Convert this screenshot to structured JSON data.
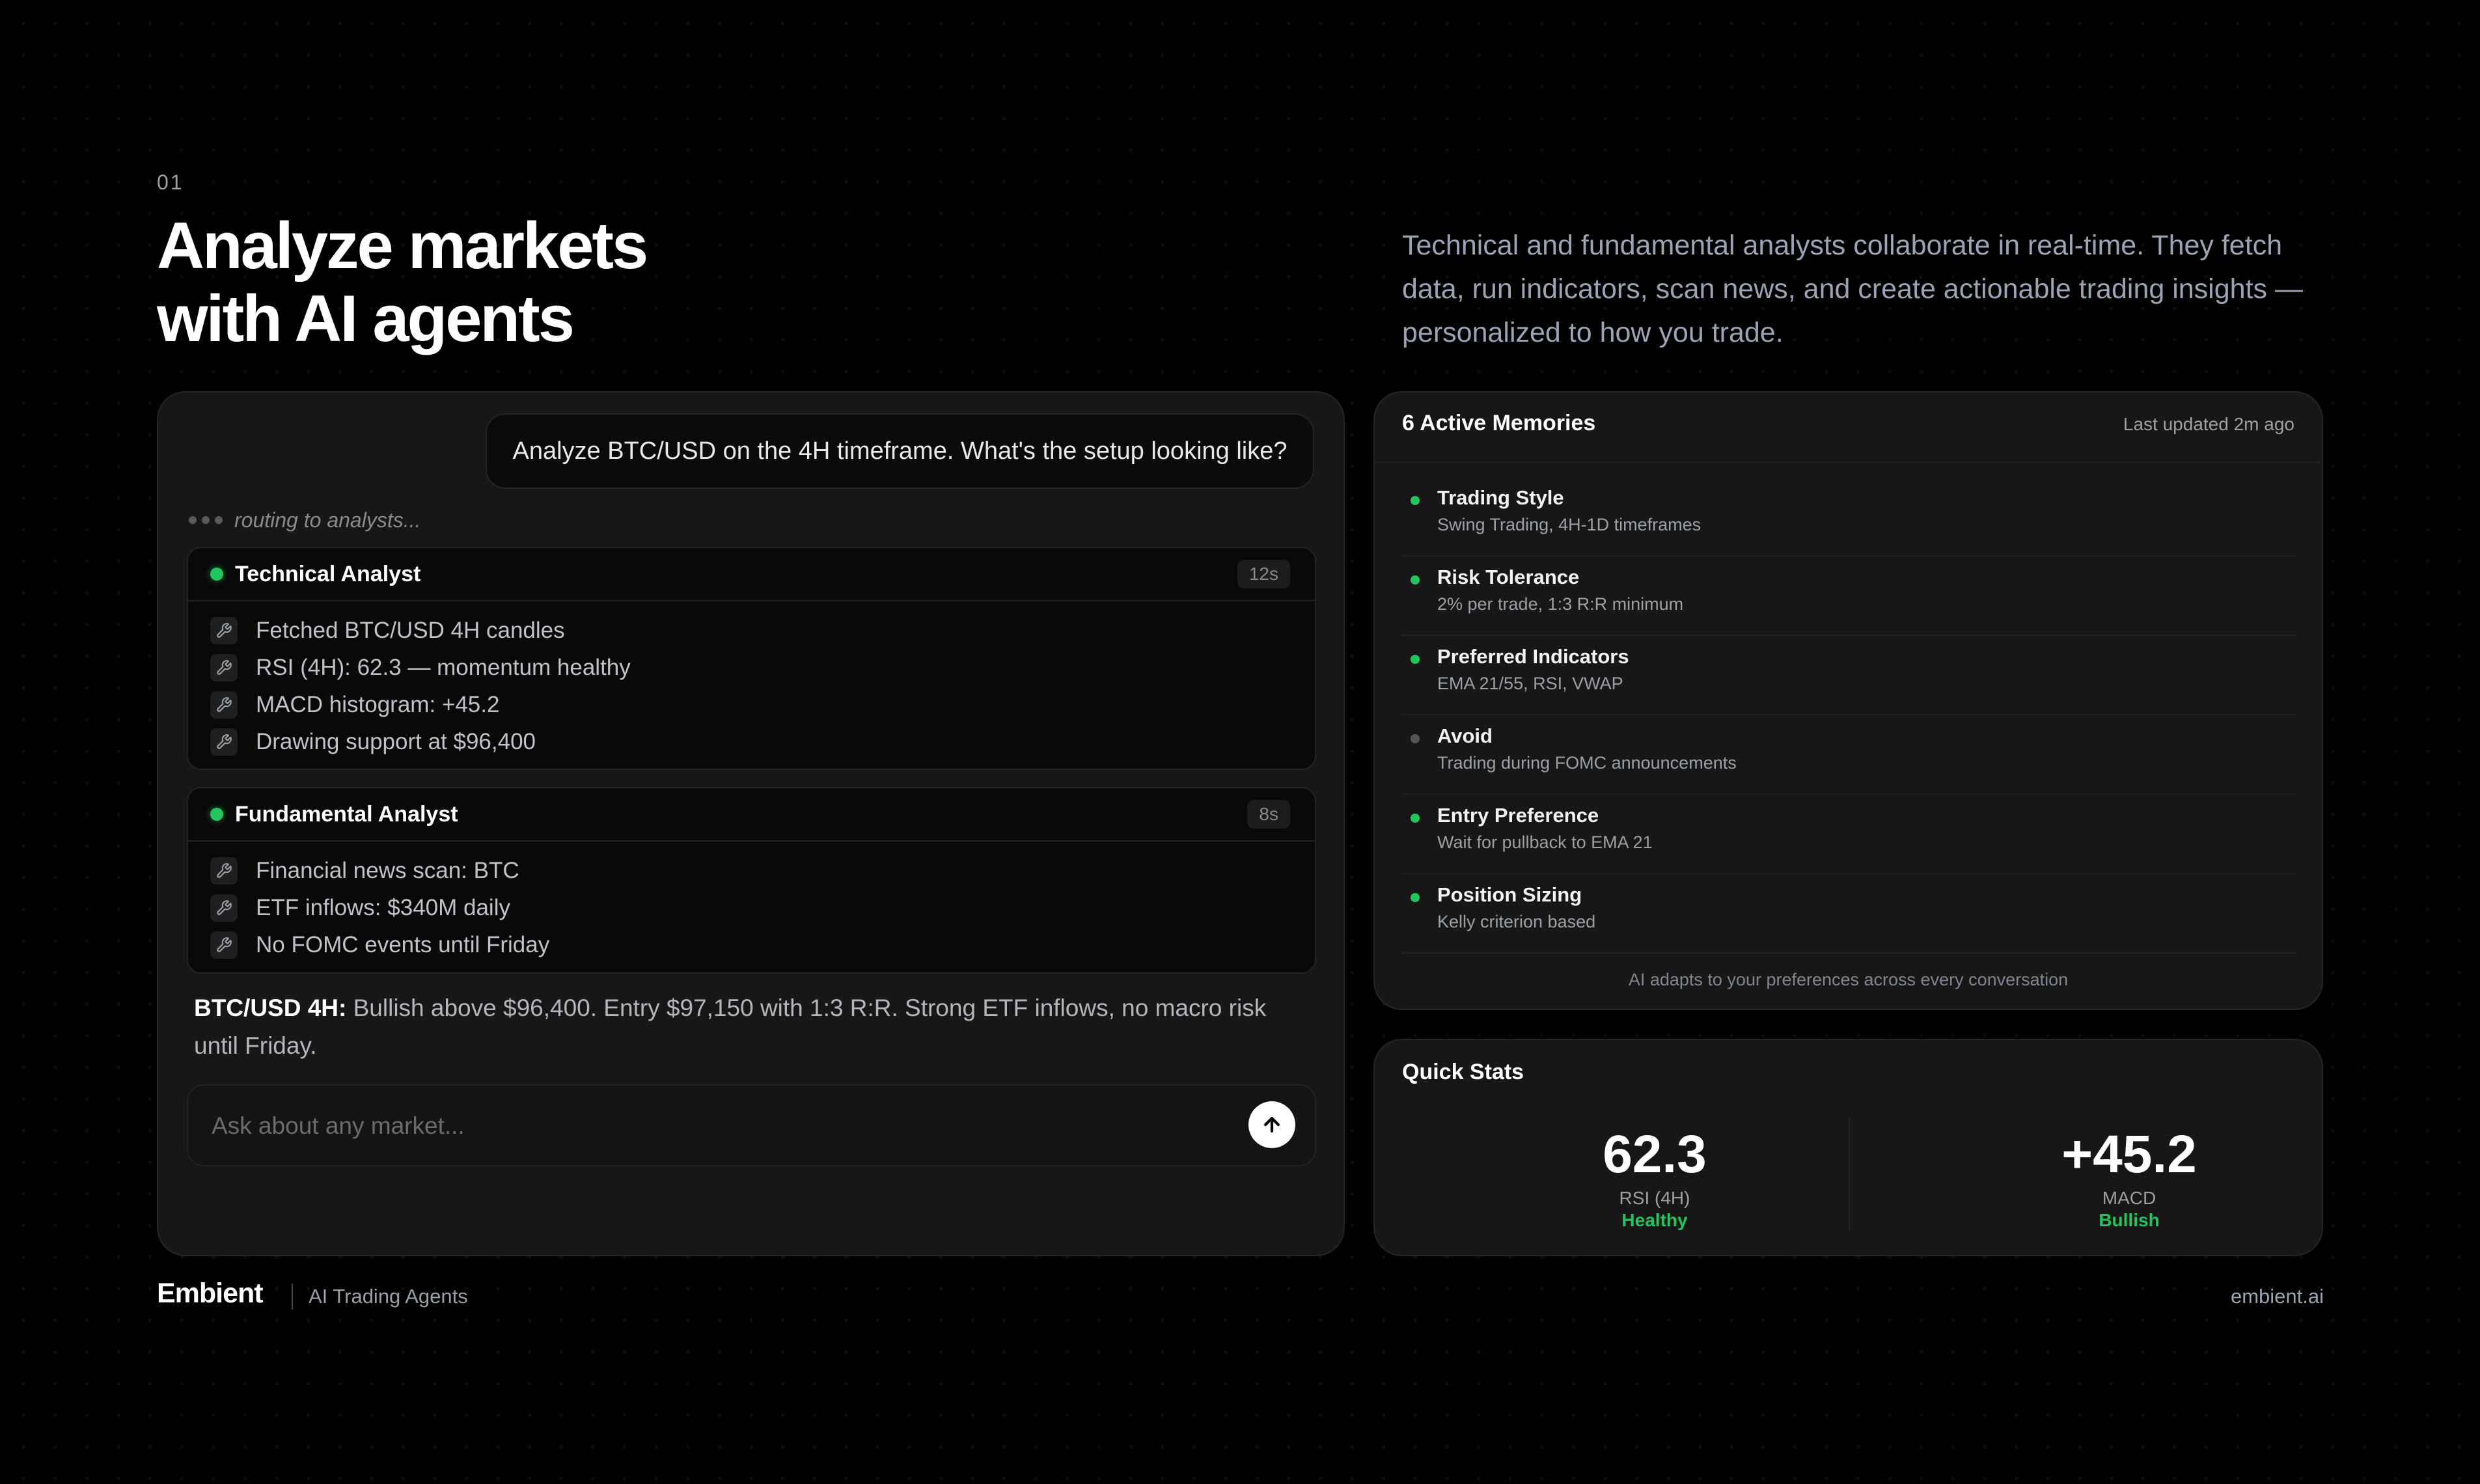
{
  "hero": {
    "section_number": "01",
    "title_line1": "Analyze markets",
    "title_line2": "with AI agents",
    "description": "Technical and fundamental analysts collaborate in real-time. They fetch data, run indicators, scan news, and create actionable trading insights — personalized to how you trade."
  },
  "chat": {
    "user_message": "Analyze BTC/USD on the 4H timeframe. What's the setup looking like?",
    "routing_text": "routing to analysts...",
    "technical": {
      "name": "Technical Analyst",
      "time": "12s",
      "steps": [
        "Fetched BTC/USD 4H candles",
        "RSI (4H): 62.3 — momentum healthy",
        "MACD histogram: +45.2",
        "Drawing support at $96,400"
      ]
    },
    "fundamental": {
      "name": "Fundamental Analyst",
      "time": "8s",
      "steps": [
        "Financial news scan: BTC",
        "ETF inflows: $340M daily",
        "No FOMC events until Friday"
      ]
    },
    "summary_label": "BTC/USD 4H:",
    "summary_text": "Bullish above $96,400. Entry $97,150 with 1:3 R:R. Strong ETF inflows, no macro risk until Friday.",
    "input_placeholder": "Ask about any market...",
    "send_icon": "arrow-up-icon"
  },
  "memories": {
    "title": "6 Active Memories",
    "updated": "Last updated 2m ago",
    "items": [
      {
        "label": "Trading Style",
        "value": "Swing Trading, 4H-1D timeframes",
        "active": true
      },
      {
        "label": "Risk Tolerance",
        "value": "2% per trade, 1:3 R:R minimum",
        "active": true
      },
      {
        "label": "Preferred Indicators",
        "value": "EMA 21/55, RSI, VWAP",
        "active": true
      },
      {
        "label": "Avoid",
        "value": "Trading during FOMC announcements",
        "active": false
      },
      {
        "label": "Entry Preference",
        "value": "Wait for pullback to EMA 21",
        "active": true
      },
      {
        "label": "Position Sizing",
        "value": "Kelly criterion based",
        "active": true
      }
    ],
    "footer": "AI adapts to your preferences across every conversation"
  },
  "stats": {
    "title": "Quick Stats",
    "items": [
      {
        "value": "62.3",
        "label": "RSI (4H)",
        "status": "Healthy"
      },
      {
        "value": "+45.2",
        "label": "MACD",
        "status": "Bullish"
      }
    ]
  },
  "footer": {
    "brand": "Embient",
    "tagline": "AI Trading Agents",
    "link": "embient.ai"
  },
  "colors": {
    "accent_green": "#22c55e",
    "background": "#000000",
    "panel": "#171717"
  }
}
